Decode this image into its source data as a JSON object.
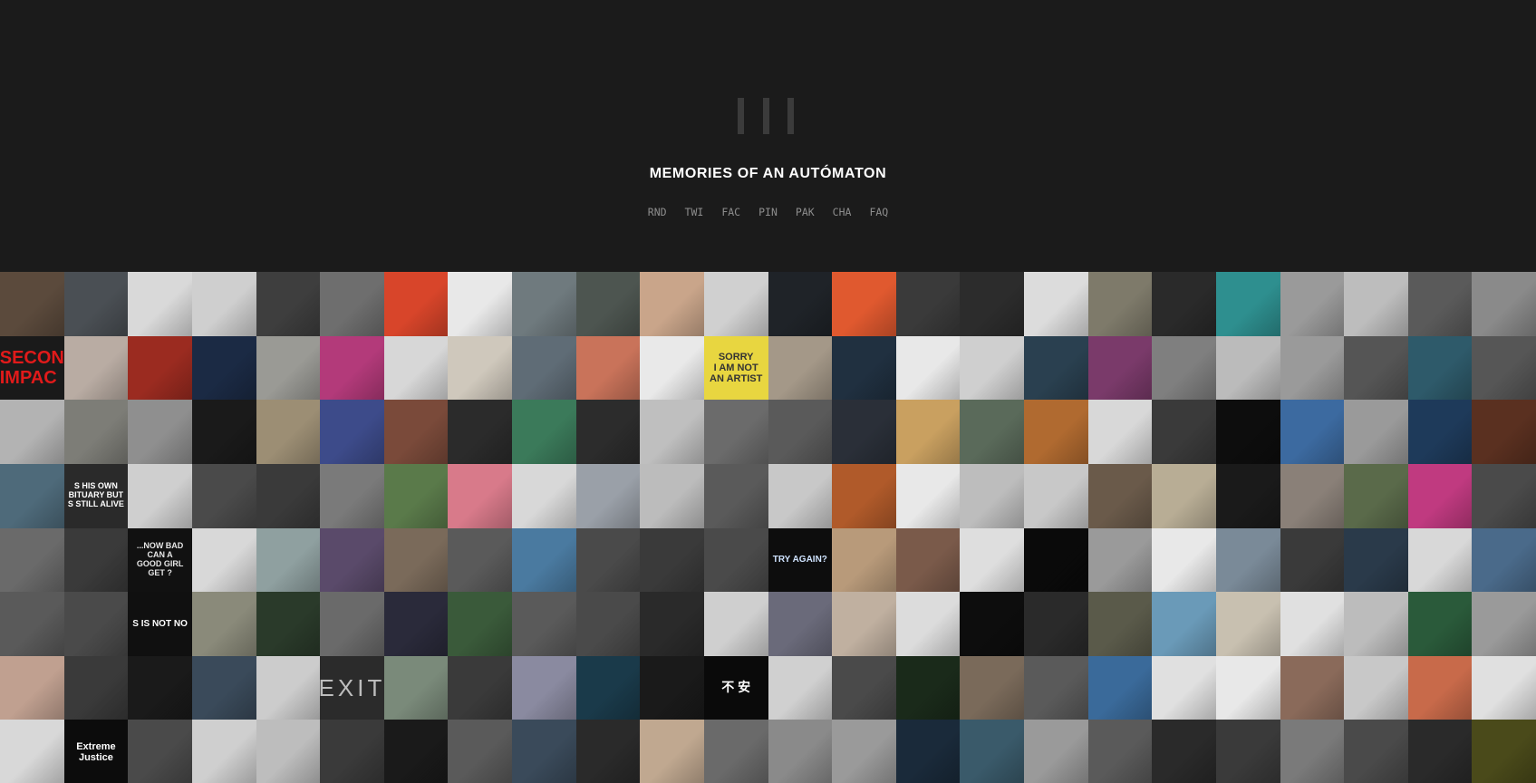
{
  "site": {
    "title": "MEMORIES OF AN AUTÓMATON",
    "logo_icon": "three-bars-icon"
  },
  "nav": [
    {
      "label": "RND"
    },
    {
      "label": "TWI"
    },
    {
      "label": "FAC"
    },
    {
      "label": "PIN"
    },
    {
      "label": "PAK"
    },
    {
      "label": "CHA"
    },
    {
      "label": "FAQ"
    }
  ],
  "grid": {
    "rows": 8,
    "columns": 24,
    "captions": [
      {
        "row": 1,
        "col": 0,
        "text": "SECON\nIMPAC",
        "color": "#e01a1a",
        "bg": "#1a1a1a"
      },
      {
        "row": 1,
        "col": 11,
        "text": "SORRY\nI AM NOT\nAN ARTIST",
        "color": "#333333",
        "bg": "#e8d640"
      },
      {
        "row": 3,
        "col": 1,
        "text": "S HIS OWN\nBITUARY BUT\nS STILL ALIVE",
        "color": "#ffffff",
        "bg": "#2a2a2a"
      },
      {
        "row": 4,
        "col": 2,
        "text": "...NOW BAD\nCAN A\nGOOD GIRL\nGET ?",
        "color": "#e6e6e6",
        "bg": "#111111"
      },
      {
        "row": 4,
        "col": 12,
        "text": "TRY AGAIN?",
        "color": "#cfe3ff",
        "bg": "#0d0d0d"
      },
      {
        "row": 5,
        "col": 2,
        "text": "S IS NOT NO",
        "color": "#ffffff",
        "bg": "#101010"
      },
      {
        "row": 6,
        "col": 5,
        "text": "EXIT",
        "color": "#bdbdbd",
        "bg": "#2b2b2b"
      },
      {
        "row": 6,
        "col": 11,
        "text": "不 安",
        "color": "#ffffff",
        "bg": "#0a0a0a"
      },
      {
        "row": 7,
        "col": 1,
        "text": "Extreme Justice",
        "color": "#ffffff",
        "bg": "#0c0c0c"
      }
    ],
    "tile_colors": [
      [
        "#5b4a3c",
        "#4a4f54",
        "#d9d9d9",
        "#cfcfcf",
        "#3e3e3e",
        "#6e6e6e",
        "#d8452a",
        "#e8e8e8",
        "#6f7a7e",
        "#4d5550",
        "#c9a58a",
        "#d0d0d0",
        "#1f2328",
        "#e0592f",
        "#3a3a3a",
        "#2c2c2c",
        "#dcdcdc",
        "#7e7a6a",
        "#2a2a2a",
        "#2e8f8f",
        "#9a9a9a",
        "#bdbdbd",
        "#5a5a5a",
        "#8a8a8a"
      ],
      [
        "#1a1a1a",
        "#b9aca3",
        "#9b2b20",
        "#1b2a44",
        "#9a9a95",
        "#b33a7a",
        "#d7d7d7",
        "#cfc8bc",
        "#5f6c76",
        "#c9735a",
        "#e9e9e9",
        "#e8d640",
        "#a49888",
        "#203040",
        "#e8e8e8",
        "#cfcfcf",
        "#2a4050",
        "#7a3a6a",
        "#7f7f7f",
        "#bbbbbb",
        "#9a9a9a",
        "#555555",
        "#2e5a6a",
        "#565656"
      ],
      [
        "#b3b3b3",
        "#7d7d77",
        "#8f8f8f",
        "#1a1a1a",
        "#9c8e74",
        "#3d4b8a",
        "#7a4a3a",
        "#2b2b2b",
        "#3b7a5a",
        "#2c2c2c",
        "#bfbfbf",
        "#6b6b6b",
        "#5a5a5a",
        "#2a2f38",
        "#c9a060",
        "#5a6a5a",
        "#b06a30",
        "#d8d8d8",
        "#3a3a3a",
        "#0d0d0d",
        "#3c6aa0",
        "#9a9a9a",
        "#1e3a5a",
        "#5a3020"
      ],
      [
        "#4e6a7a",
        "#2a2a2a",
        "#cfcfcf",
        "#4a4a4a",
        "#3a3a3a",
        "#7a7a7a",
        "#5a7a4a",
        "#d87a8a",
        "#d8d8d8",
        "#9aa0a8",
        "#bcbcbc",
        "#5a5a5a",
        "#c8c8c8",
        "#b05a2a",
        "#e8e8e8",
        "#bdbdbd",
        "#c8c8c8",
        "#6a5a4a",
        "#b8ad95",
        "#1a1a1a",
        "#8a8078",
        "#5a6a4a",
        "#c03a80",
        "#4a4a4a"
      ],
      [
        "#6a6a6a",
        "#3a3a3a",
        "#111111",
        "#d8d8d8",
        "#8fa0a0",
        "#5a4a6a",
        "#7a6a5a",
        "#5a5a5a",
        "#4a7aa0",
        "#4a4a4a",
        "#3a3a3a",
        "#4a4a4a",
        "#0d0d0d",
        "#b89a7a",
        "#7a5a4a",
        "#dedede",
        "#0a0a0a",
        "#9a9a9a",
        "#e8e8e8",
        "#7a8a98",
        "#3a3a3a",
        "#2a3a4a",
        "#d8d8d8",
        "#4a6a8a"
      ],
      [
        "#5a5a5a",
        "#4a4a4a",
        "#101010",
        "#8a8a7a",
        "#2a3a2a",
        "#6a6a6a",
        "#2a2a3a",
        "#3a5a3a",
        "#5a5a5a",
        "#4a4a4a",
        "#2a2a2a",
        "#cfcfcf",
        "#6a6a7a",
        "#c0b0a0",
        "#dcdcdc",
        "#0d0d0d",
        "#2a2a2a",
        "#5a5a4a",
        "#6a9ab8",
        "#c8c0b0",
        "#e0e0e0",
        "#bcbcbc",
        "#2a5a3a",
        "#9a9a9a"
      ],
      [
        "#c0a090",
        "#3a3a3a",
        "#1a1a1a",
        "#3a4a5a",
        "#cccccc",
        "#2b2b2b",
        "#7a8a7a",
        "#3a3a3a",
        "#8a8aa0",
        "#1a3a4a",
        "#1a1a1a",
        "#0a0a0a",
        "#d0d0d0",
        "#4a4a4a",
        "#1a2a1a",
        "#7a6a5a",
        "#5a5a5a",
        "#3a6a9a",
        "#e0e0e0",
        "#e8e8e8",
        "#8a6a5a",
        "#c8c8c8",
        "#c86a4a",
        "#e0e0e0"
      ],
      [
        "#d8d8d8",
        "#0c0c0c",
        "#4a4a4a",
        "#cfcfcf",
        "#bdbdbd",
        "#3a3a3a",
        "#1a1a1a",
        "#5a5a5a",
        "#3a4a5a",
        "#2a2a2a",
        "#c0a890",
        "#6a6a6a",
        "#8a8a8a",
        "#9a9a9a",
        "#1a2a3a",
        "#3a5a6a",
        "#9a9a9a",
        "#5a5a5a",
        "#2a2a2a",
        "#3a3a3a",
        "#7a7a7a",
        "#4a4a4a",
        "#2a2a2a",
        "#4a4a1a"
      ]
    ]
  }
}
